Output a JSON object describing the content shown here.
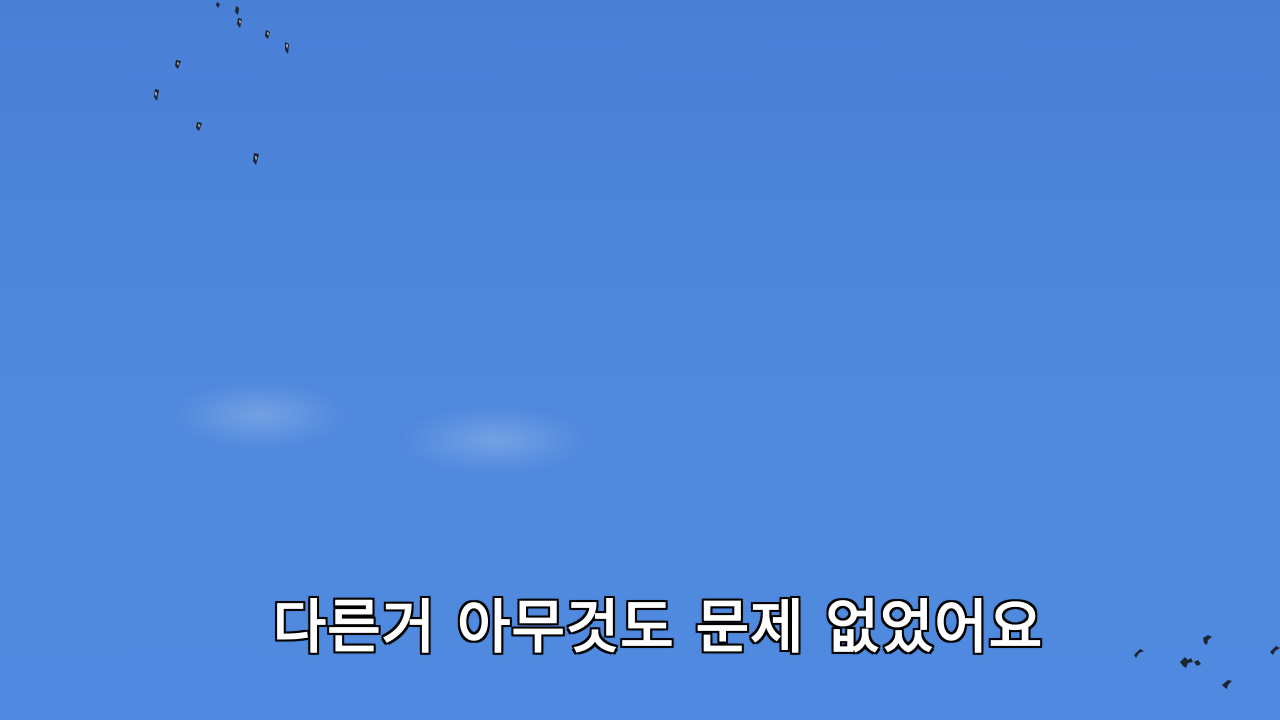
{
  "scene": {
    "description_icon": "sky-with-birds",
    "sky_color": "#4d86db"
  },
  "subtitle": {
    "text": "다른거 아무것도 문제 없었어요"
  }
}
